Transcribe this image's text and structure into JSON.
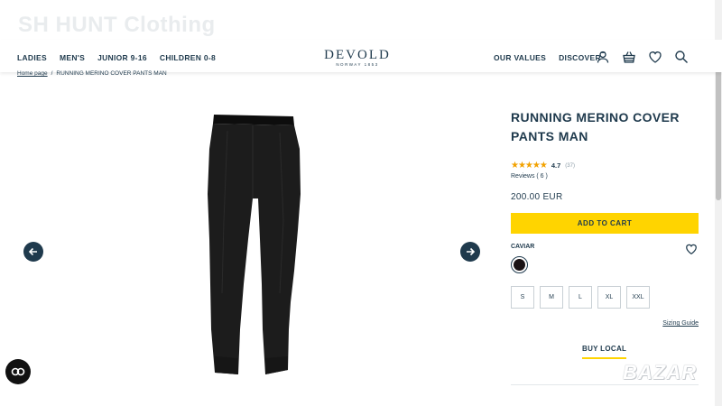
{
  "watermark_top": "SH HUNT Clothing",
  "header": {
    "nav_left": [
      "LADIES",
      "MEN'S",
      "JUNIOR 9-16",
      "CHILDREN 0-8"
    ],
    "logo": {
      "brand": "DEVOLD",
      "sub": "NORWAY 1853"
    },
    "nav_right": [
      "OUR VALUES",
      "DISCOVER"
    ],
    "icons": [
      "account-icon",
      "basket-icon",
      "wishlist-heart-icon",
      "search-icon"
    ]
  },
  "breadcrumb": {
    "home": "Home page",
    "current": "RUNNING MERINO COVER PANTS MAN"
  },
  "product": {
    "title": "RUNNING MERINO COVER PANTS MAN",
    "rating_stars": "★★★★★",
    "rating_value": "4.7",
    "rating_count": "(37)",
    "reviews": "Reviews ( 6 )",
    "price": "200.00 EUR",
    "add_to_cart": "ADD TO CART",
    "color_label": "CAVIAR",
    "sizes": [
      "S",
      "M",
      "L",
      "XL",
      "XXL"
    ],
    "sizing_guide": "Sizing Guide",
    "buy_local": "BUY LOCAL"
  },
  "colors": {
    "accent": "#ffd400",
    "text": "#1f3a4d",
    "star": "#f2a200",
    "swatch": "#1a1214"
  },
  "watermark_bottom": "BAZAR"
}
